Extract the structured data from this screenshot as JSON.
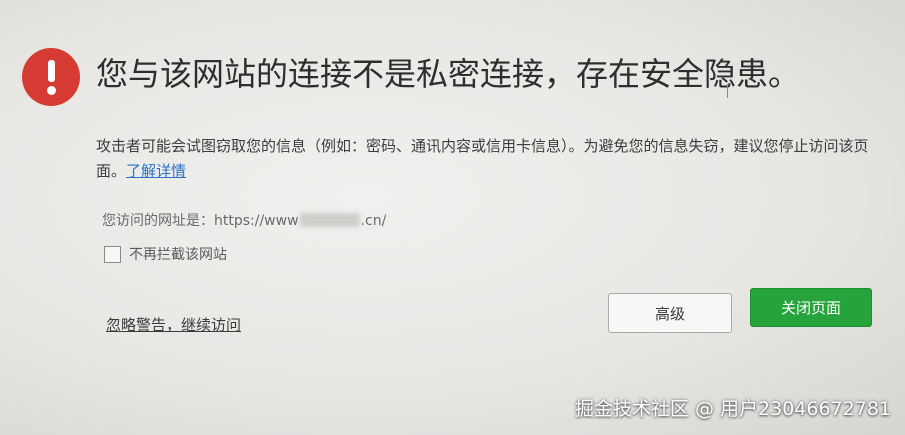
{
  "warning": {
    "headline": "您与该网站的连接不是私密连接，存在安全隐患。",
    "description": "攻击者可能会试图窃取您的信息（例如：密码、通讯内容或信用卡信息）。为避免您的信息失窃，建议您停止访问该页面。",
    "learn_more": "了解详情",
    "url_prefix": "您访问的网址是：https://www",
    "url_suffix": ".cn/",
    "dont_block_label": "不再拦截该网站",
    "ignore_link": "忽略警告，继续访问"
  },
  "buttons": {
    "advanced": "高级",
    "close_page": "关闭页面"
  },
  "watermark": "掘金技术社区 @ 用户23046672781",
  "colors": {
    "icon_red": "#d63b33",
    "close_green": "#27a33c",
    "link_blue": "#2a73c8"
  },
  "icons": {
    "warning": "exclamation-circle-icon"
  }
}
